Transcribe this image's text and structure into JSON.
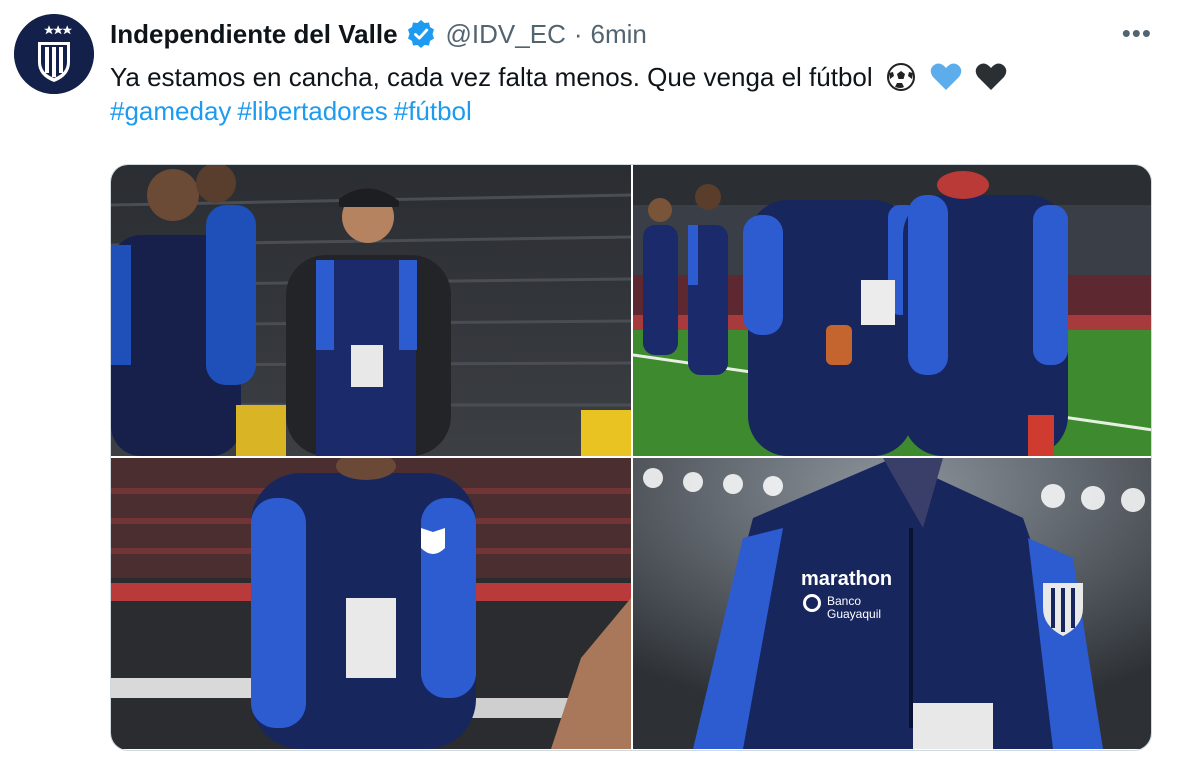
{
  "tweet": {
    "display_name": "Independiente del Valle",
    "handle": "@IDV_EC",
    "separator": "·",
    "time": "6min",
    "more_label": "•••",
    "text": "Ya estamos en cancha, cada vez falta menos. Que venga el fútbol",
    "emojis": [
      "soccer-ball-icon",
      "blue-heart-icon",
      "black-heart-icon"
    ],
    "hashtags": [
      "#gameday",
      "#libertadores",
      "#fútbol"
    ]
  },
  "media": {
    "photos": [
      {
        "name": "coach-smiling-in-stadium"
      },
      {
        "name": "players-on-pitch"
      },
      {
        "name": "player-with-credential"
      },
      {
        "name": "jacket-closeup"
      }
    ],
    "jacket_sponsor": "marathon",
    "bank_sponsor_line1": "Banco",
    "bank_sponsor_line2": "Guayaquil"
  },
  "colors": {
    "accent": "#1d9bf0",
    "text": "#0f1419",
    "muted": "#536471",
    "club_navy": "#12204a",
    "jacket_blue": "#1f4fb8"
  }
}
